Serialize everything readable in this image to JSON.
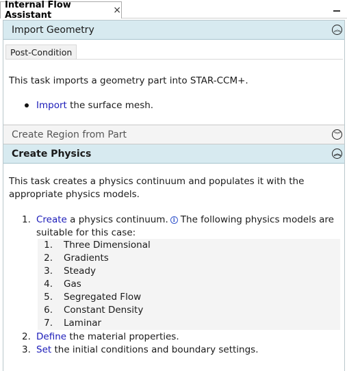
{
  "window": {
    "tab_title": "Internal Flow Assistant",
    "close_glyph": "×",
    "minimize_icon": "minimize-icon"
  },
  "sections": {
    "import_geometry": {
      "title": "Import Geometry",
      "post_condition_label": "Post-Condition",
      "description": "This task imports a geometry part into STAR-CCM+.",
      "bullet_link": "Import",
      "bullet_text": " the surface mesh."
    },
    "create_region": {
      "title": "Create Region from Part"
    },
    "create_physics": {
      "title": "Create Physics",
      "description_line1": "This task creates a physics continuum and populates it with the",
      "description_line2": "appropriate physics models.",
      "step1_num": "1.",
      "step1_link": "Create",
      "step1_text_a": " a physics continuum.",
      "step1_text_b": "The following physics models are",
      "step1_text_c": "suitable for this case:",
      "models": [
        {
          "num": "1.",
          "label": "Three Dimensional"
        },
        {
          "num": "2.",
          "label": "Gradients"
        },
        {
          "num": "3.",
          "label": "Steady"
        },
        {
          "num": "4.",
          "label": "Gas"
        },
        {
          "num": "5.",
          "label": "Segregated Flow"
        },
        {
          "num": "6.",
          "label": "Constant Density"
        },
        {
          "num": "7.",
          "label": "Laminar"
        }
      ],
      "step2_num": "2.",
      "step2_link": "Define",
      "step2_text": " the material properties.",
      "step3_num": "3.",
      "step3_link": "Set",
      "step3_text": " the initial conditions and boundary settings."
    }
  },
  "colors": {
    "active_header_bg": "#d7eaf0",
    "link": "#1a1ab8"
  }
}
